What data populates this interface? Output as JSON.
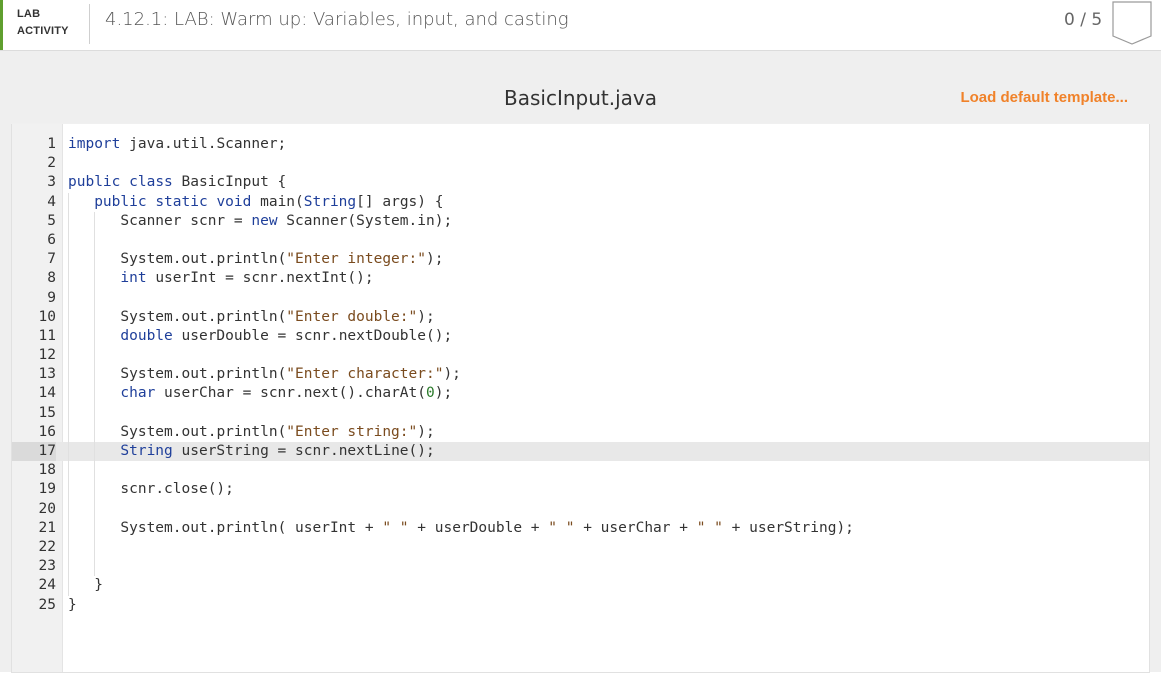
{
  "header": {
    "lab_line1": "LAB",
    "lab_line2": "ACTIVITY",
    "title": "4.12.1: LAB: Warm up: Variables, input, and casting",
    "score": "0 / 5",
    "accent_color": "#5f9f2f"
  },
  "editor": {
    "filename": "BasicInput.java",
    "load_template_label": "Load default template...",
    "load_template_color": "#f0822a",
    "active_line": 17,
    "lines": [
      {
        "n": "1",
        "text": "import java.util.Scanner;"
      },
      {
        "n": "2",
        "text": ""
      },
      {
        "n": "3",
        "text": "public class BasicInput {"
      },
      {
        "n": "4",
        "text": "   public static void main(String[] args) {"
      },
      {
        "n": "5",
        "text": "      Scanner scnr = new Scanner(System.in);"
      },
      {
        "n": "6",
        "text": ""
      },
      {
        "n": "7",
        "text": "      System.out.println(\"Enter integer:\");"
      },
      {
        "n": "8",
        "text": "      int userInt = scnr.nextInt();"
      },
      {
        "n": "9",
        "text": ""
      },
      {
        "n": "10",
        "text": "      System.out.println(\"Enter double:\");"
      },
      {
        "n": "11",
        "text": "      double userDouble = scnr.nextDouble();"
      },
      {
        "n": "12",
        "text": ""
      },
      {
        "n": "13",
        "text": "      System.out.println(\"Enter character:\");"
      },
      {
        "n": "14",
        "text": "      char userChar = scnr.next().charAt(0);"
      },
      {
        "n": "15",
        "text": ""
      },
      {
        "n": "16",
        "text": "      System.out.println(\"Enter string:\");"
      },
      {
        "n": "17",
        "text": "      String userString = scnr.nextLine();"
      },
      {
        "n": "18",
        "text": ""
      },
      {
        "n": "19",
        "text": "      scnr.close();"
      },
      {
        "n": "20",
        "text": ""
      },
      {
        "n": "21",
        "text": "      System.out.println( userInt + \" \" + userDouble + \" \" + userChar + \" \" + userString);"
      },
      {
        "n": "22",
        "text": ""
      },
      {
        "n": "23",
        "text": ""
      },
      {
        "n": "24",
        "text": "   }"
      },
      {
        "n": "25",
        "text": "}"
      }
    ]
  }
}
